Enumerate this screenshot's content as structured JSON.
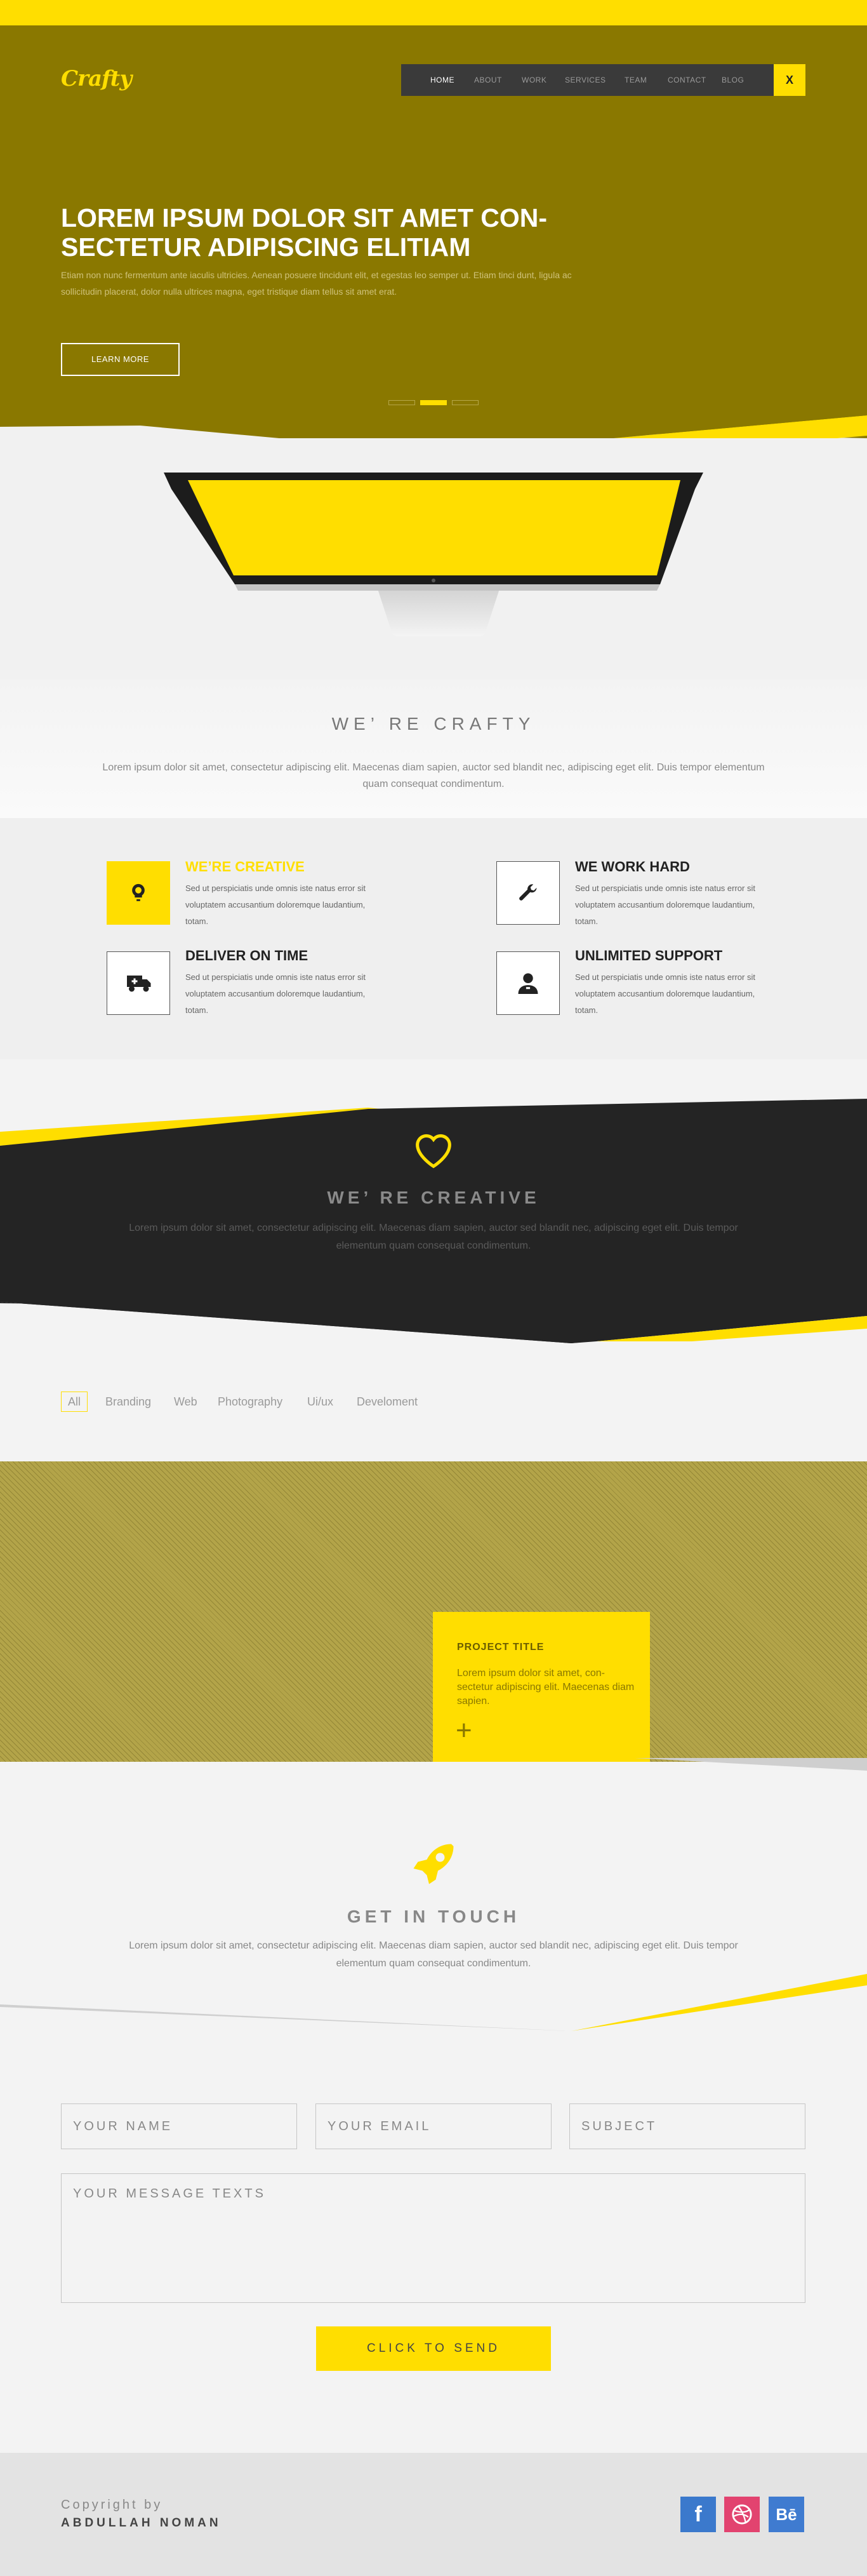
{
  "colors": {
    "accent": "#ffde00",
    "hero_bg": "#8a7800",
    "dark_band": "#242424",
    "facebook": "#3b79cc",
    "dribbble": "#e2436f",
    "behance": "#3f7bd0"
  },
  "header": {
    "logo": "Crafty",
    "nav": [
      "HOME",
      "ABOUT",
      "WORK",
      "SERVICES",
      "TEAM",
      "CONTACT",
      "BLOG"
    ],
    "active_nav": "HOME",
    "close_label": "X"
  },
  "hero": {
    "title": "LOREM IPSUM DOLOR SIT AMET CON- SECTETUR ADIPISCING ELITIAM",
    "text": "Etiam non nunc fermentum ante iaculis ultricies. Aenean posuere tincidunt elit, et egestas leo semper ut. Etiam tinci dunt, ligula ac sollicitudin placerat, dolor nulla ultrices magna, eget tristique diam tellus sit amet erat.",
    "button": "LEARN MORE",
    "slides": 3,
    "active_slide": 2
  },
  "about": {
    "heading": "WE’ RE  CRAFTY",
    "text": "Lorem ipsum dolor sit amet, consectetur adipiscing elit. Maecenas diam sapien, auctor sed blandit nec, adipiscing eget elit. Duis tempor elementum quam consequat condimentum.",
    "features": [
      {
        "title": "WE’RE CREATIVE",
        "text": "Sed ut perspiciatis unde omnis iste natus error sit voluptatem accusantium doloremque laudantium, totam.",
        "icon": "lightbulb-icon"
      },
      {
        "title": "WE WORK HARD",
        "text": "Sed ut perspiciatis unde omnis iste natus error sit voluptatem accusantium doloremque laudantium, totam.",
        "icon": "wrench-icon"
      },
      {
        "title": "DELIVER ON TIME",
        "text": "Sed ut perspiciatis unde omnis iste natus error sit voluptatem accusantium doloremque laudantium, totam.",
        "icon": "truck-icon"
      },
      {
        "title": "UNLIMITED SUPPORT",
        "text": "Sed ut perspiciatis unde omnis iste natus error sit voluptatem accusantium doloremque laudantium, totam.",
        "icon": "user-support-icon"
      }
    ]
  },
  "creative": {
    "icon": "heart-icon",
    "heading": "WE’ RE CREATIVE",
    "text": "Lorem ipsum dolor sit amet, consectetur adipiscing elit. Maecenas diam sapien, auctor sed blandit nec, adipiscing eget elit. Duis tempor elementum quam consequat condimentum."
  },
  "portfolio": {
    "filters": [
      "All",
      "Branding",
      "Web",
      "Photography",
      "Ui/ux",
      "Develoment"
    ],
    "active_filter": "All",
    "project_title": "PROJECT TITLE",
    "project_text": "Lorem ipsum dolor sit amet, con- sectetur adipiscing elit. Maecenas diam sapien.",
    "project_plus": "+"
  },
  "contact": {
    "icon": "rocket-icon",
    "heading": "GET IN TOUCH",
    "text": "Lorem ipsum dolor sit amet, consectetur adipiscing elit. Maecenas diam sapien, auctor sed blandit nec, adipiscing eget elit. Duis tempor elementum quam consequat condimentum.",
    "name_placeholder": "YOUR NAME",
    "email_placeholder": "YOUR EMAIL",
    "subject_placeholder": "SUBJECT",
    "message_placeholder": "YOUR MESSAGE TEXTS",
    "send_label": "CLICK TO SEND"
  },
  "footer": {
    "copyright_label": "Copyright by",
    "copyright_name": "ABDULLAH NOMAN",
    "social": [
      {
        "label": "f",
        "icon": "facebook-icon"
      },
      {
        "label": "dribbble",
        "icon": "dribbble-icon"
      },
      {
        "label": "Bē",
        "icon": "behance-icon"
      }
    ]
  }
}
